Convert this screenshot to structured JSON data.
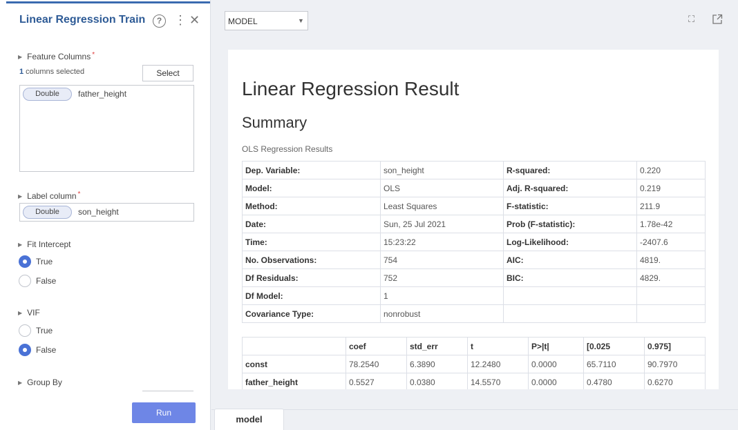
{
  "panel": {
    "title": "Linear Regression Train",
    "feature_columns": {
      "label": "Feature Columns",
      "required_mark": "*",
      "selected_count": "1",
      "selected_suffix": " columns selected",
      "select_button": "Select",
      "items": [
        {
          "type": "Double",
          "name": "father_height"
        }
      ]
    },
    "label_column": {
      "label": "Label column",
      "required_mark": "*",
      "type": "Double",
      "name": "son_height"
    },
    "fit_intercept": {
      "label": "Fit Intercept",
      "options": [
        {
          "label": "True",
          "checked": true
        },
        {
          "label": "False",
          "checked": false
        }
      ]
    },
    "vif": {
      "label": "VIF",
      "options": [
        {
          "label": "True",
          "checked": false
        },
        {
          "label": "False",
          "checked": true
        }
      ]
    },
    "group_by": {
      "label": "Group By"
    },
    "run_button": "Run"
  },
  "toolbar": {
    "model_select_value": "MODEL"
  },
  "result": {
    "title": "Linear Regression Result",
    "summary_heading": "Summary",
    "caption": "OLS Regression Results",
    "summary_rows": [
      [
        "Dep. Variable:",
        "son_height",
        "R-squared:",
        "0.220"
      ],
      [
        "Model:",
        "OLS",
        "Adj. R-squared:",
        "0.219"
      ],
      [
        "Method:",
        "Least Squares",
        "F-statistic:",
        "211.9"
      ],
      [
        "Date:",
        "Sun, 25 Jul 2021",
        "Prob (F-statistic):",
        "1.78e-42"
      ],
      [
        "Time:",
        "15:23:22",
        "Log-Likelihood:",
        "-2407.6"
      ],
      [
        "No. Observations:",
        "754",
        "AIC:",
        "4819."
      ],
      [
        "Df Residuals:",
        "752",
        "BIC:",
        "4829."
      ],
      [
        "Df Model:",
        "1",
        "",
        ""
      ],
      [
        "Covariance Type:",
        "nonrobust",
        "",
        ""
      ]
    ],
    "coef_headers": [
      "",
      "coef",
      "std_err",
      "t",
      "P>|t|",
      "[0.025",
      "0.975]"
    ],
    "coef_rows": [
      [
        "const",
        "78.2540",
        "6.3890",
        "12.2480",
        "0.0000",
        "65.7110",
        "90.7970"
      ],
      [
        "father_height",
        "0.5527",
        "0.0380",
        "14.5570",
        "0.0000",
        "0.4780",
        "0.6270"
      ]
    ]
  },
  "bottom_tabs": [
    {
      "label": "model",
      "active": true
    }
  ]
}
